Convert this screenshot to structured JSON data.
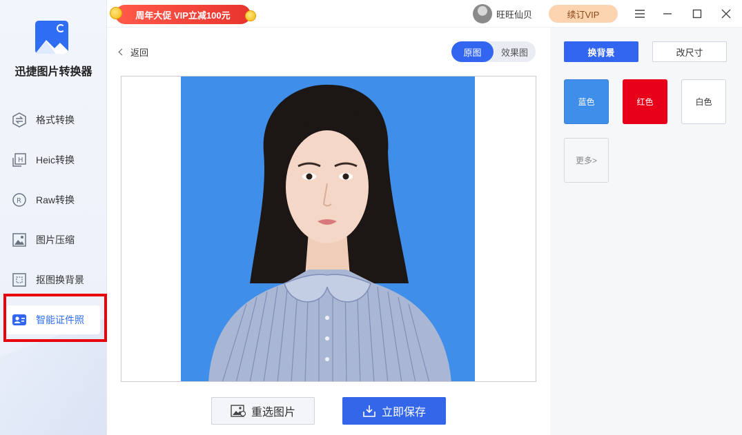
{
  "app": {
    "name": "迅捷图片转换器"
  },
  "sidebar": {
    "items": [
      {
        "label": "格式转换",
        "icon": "format-convert-icon"
      },
      {
        "label": "Heic转换",
        "icon": "heic-icon"
      },
      {
        "label": "Raw转换",
        "icon": "raw-icon"
      },
      {
        "label": "图片压缩",
        "icon": "image-compress-icon"
      },
      {
        "label": "抠图换背景",
        "icon": "cutout-icon"
      },
      {
        "label": "智能证件照",
        "icon": "id-photo-icon"
      }
    ],
    "active_index": 5
  },
  "topbar": {
    "promo": "周年大促 VIP立减100元",
    "username": "旺旺仙贝",
    "renew": "续订VIP"
  },
  "main": {
    "back": "返回",
    "toggle": {
      "original": "原图",
      "result": "效果图",
      "selected": "原图"
    },
    "reselect_button": "重选图片",
    "save_button": "立即保存"
  },
  "right_panel": {
    "tabs": {
      "change_bg": "换背景",
      "resize": "改尺寸",
      "selected": "换背景"
    },
    "colors": [
      {
        "label": "蓝色",
        "hex": "#3f8ee9"
      },
      {
        "label": "红色",
        "hex": "#e8001a"
      },
      {
        "label": "白色",
        "hex": "#ffffff"
      }
    ],
    "more": "更多>"
  },
  "colors": {
    "accent": "#3366f0",
    "highlight": "#e8000d",
    "photo_background": "#3f8ee9"
  }
}
